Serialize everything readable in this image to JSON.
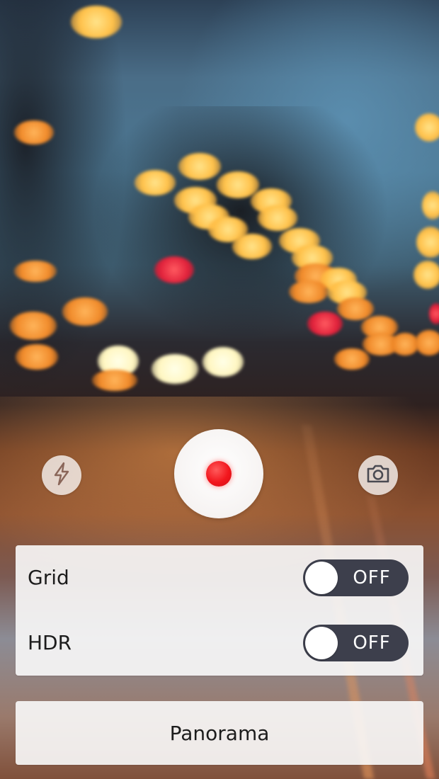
{
  "capture_controls": {
    "flash_icon": "lightning-bolt",
    "record_icon": "red-dot",
    "camera_icon": "camera",
    "record_color": "#f2161d"
  },
  "settings": [
    {
      "label": "Grid",
      "state": "OFF",
      "on": false
    },
    {
      "label": "HDR",
      "state": "OFF",
      "on": false
    }
  ],
  "panorama": {
    "label": "Panorama"
  }
}
